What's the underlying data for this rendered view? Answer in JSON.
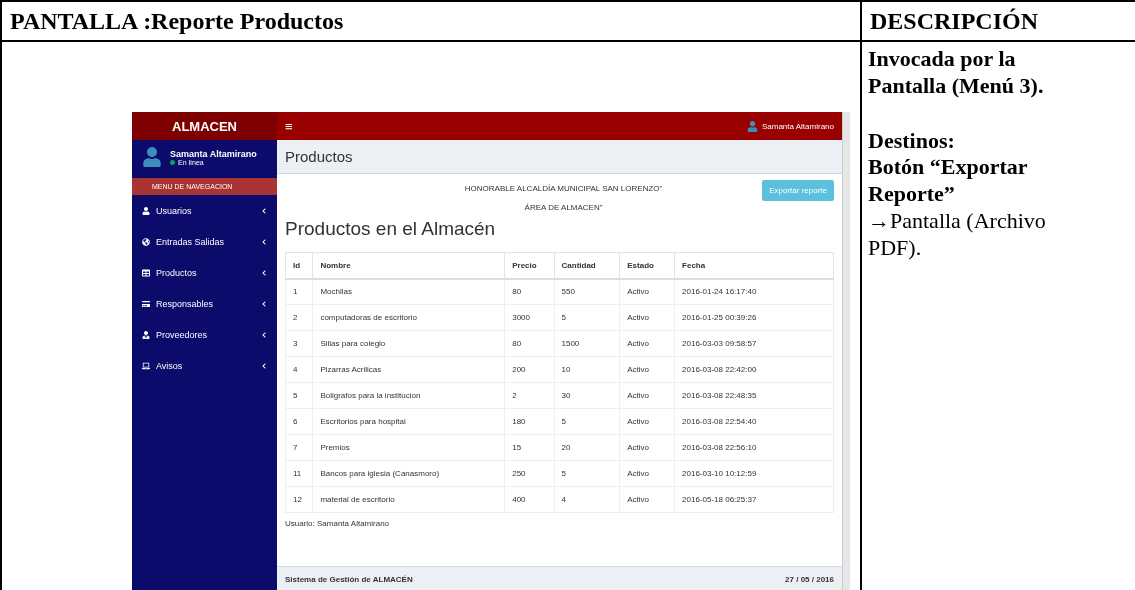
{
  "document": {
    "screen_heading": "PANTALLA :Reporte Productos",
    "description_heading": "DESCRIPCIÓN",
    "description": [
      {
        "kind": "bold",
        "text": "Invocada por la Pantalla (Menú 3)."
      },
      {
        "kind": "bold",
        "text": "Destinos:"
      },
      {
        "kind": "bold",
        "text": "Botón “Exportar Reporte”"
      },
      {
        "kind": "plain",
        "text": "→Pantalla (Archivo PDF)."
      }
    ]
  },
  "app": {
    "brand": "ALMACEN",
    "menu_toggle": "≡",
    "top_user": "Samanta Altamirano",
    "sidebar": {
      "user_name": "Samanta Altamirano",
      "status": "En línea",
      "section": "MENU DE NAVEGACION",
      "items": [
        {
          "label": "Usuarios",
          "expanded": false
        },
        {
          "label": "Entradas Salidas",
          "expanded": false
        },
        {
          "label": "Productos",
          "expanded": false
        },
        {
          "label": "Responsables",
          "expanded": false
        },
        {
          "label": "Proveedores",
          "expanded": false
        },
        {
          "label": "Avisos",
          "expanded": false
        }
      ]
    },
    "page_title": "Productos",
    "report": {
      "org_lines": [
        "HONORABLE ALCALDÍA MUNICIPAL SAN LORENZO\"",
        "ÁREA DE ALMACEN\""
      ],
      "export_button": "Exportar reporte",
      "title": "Productos en el Almacén",
      "columns": [
        "Id",
        "Nombre",
        "Precio",
        "Cantidad",
        "Estado",
        "Fecha"
      ],
      "rows": [
        [
          "1",
          "Mochilas",
          "80",
          "550",
          "Activo",
          "2016-01-24 16:17:40"
        ],
        [
          "2",
          "computadoras de escritorio",
          "3000",
          "5",
          "Activo",
          "2016-01-25 00:39:26"
        ],
        [
          "3",
          "Sillas para colegio",
          "80",
          "1500",
          "Activo",
          "2016-03-03 09:58:57"
        ],
        [
          "4",
          "Pizarras Acrilicas",
          "200",
          "10",
          "Activo",
          "2016-03-08 22:42:00"
        ],
        [
          "5",
          "Boligrafos para la institucion",
          "2",
          "30",
          "Activo",
          "2016-03-08 22:48:35"
        ],
        [
          "6",
          "Escritorios para hospital",
          "180",
          "5",
          "Activo",
          "2016-03-08 22:54:40"
        ],
        [
          "7",
          "Premios",
          "15",
          "20",
          "Activo",
          "2016-03-08 22:56:10"
        ],
        [
          "11",
          "Bancos para iglesia (Canasmoro)",
          "250",
          "5",
          "Activo",
          "2016-03-10 10:12:59"
        ],
        [
          "12",
          "material de escritorio",
          "400",
          "4",
          "Activo",
          "2016-05-18 06:25:37"
        ]
      ],
      "user_line": "Usuario: Samanta Altamirano"
    },
    "footer": {
      "system": "Sistema de Gestión de ALMACÉN",
      "date": "27 / 05 / 2016"
    }
  }
}
